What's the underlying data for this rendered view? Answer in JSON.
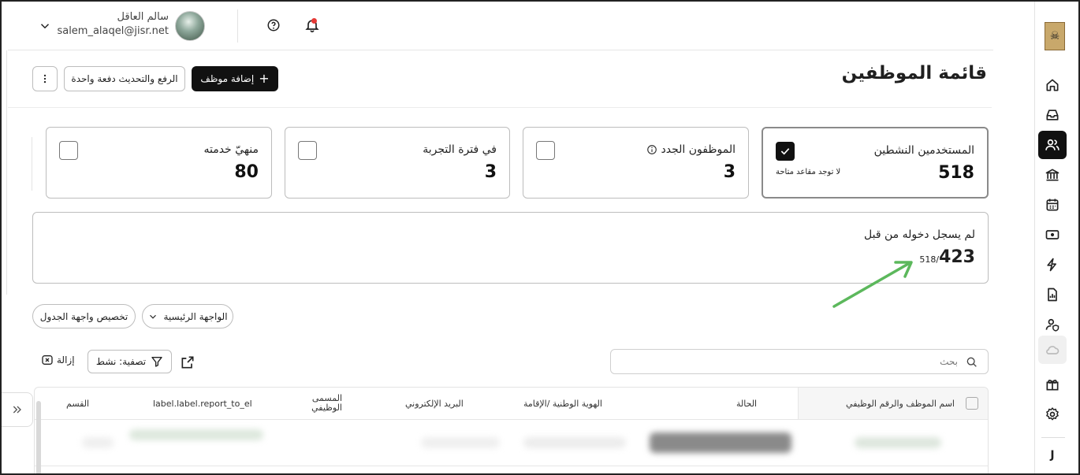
{
  "user": {
    "name": "سالم العاقل",
    "email": "salem_alaqel@jisr.net"
  },
  "header": {
    "title": "قائمة الموظفين",
    "add_button": "إضافة موظف",
    "bulk_button": "الرفع والتحديث دفعة واحدة"
  },
  "cards": [
    {
      "label": "المستخدمين النشطين",
      "value": "518",
      "note": "لا توجد مقاعد متاحة",
      "checked": true
    },
    {
      "label": "الموظفون الجدد",
      "value": "3",
      "checked": false
    },
    {
      "label": "في فترة التجربة",
      "value": "3",
      "checked": false
    },
    {
      "label": "منهيّ خدمته",
      "value": "80",
      "checked": false
    }
  ],
  "never_logged": {
    "label": "لم يسجل دخوله من قبل",
    "value": "423",
    "total": "518/"
  },
  "views": {
    "main_view": "الواجهة الرئيسية",
    "customize": "تخصيص واجهة الجدول"
  },
  "toolbar": {
    "search_placeholder": "بحث",
    "filter": "تصفية: نشط",
    "remove": "إزالة"
  },
  "table": {
    "columns": [
      "اسم الموظف والرقم الوظيفي",
      "الحالة",
      "الهوية الوطنية /الإقامة",
      "البريد الإلكتروني",
      "المسمى الوظيفي",
      "label.label.report_to_el",
      "القسم"
    ]
  },
  "sidebar": {
    "bottom_letter": "J"
  },
  "colors": {
    "primary": "#111111",
    "border": "#bdbdbd",
    "arrow": "#5cb85c",
    "notification": "#e53935"
  }
}
